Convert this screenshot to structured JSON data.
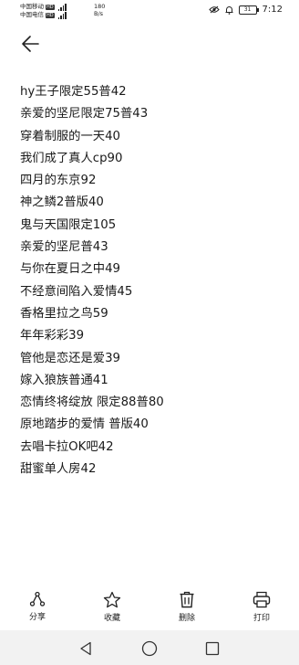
{
  "status": {
    "carrier1": "中国移动",
    "carrier2": "中国电信",
    "hd": "HD",
    "signal_label": "4G",
    "net_value": "180",
    "net_unit": "B/s",
    "battery": "31",
    "time": "7:12"
  },
  "header": {
    "back_icon": "arrow-left-icon"
  },
  "items": [
    "hy王子限定55普42",
    "亲爱的坚尼限定75普43",
    "穿着制服的一天40",
    "我们成了真人cp90",
    "四月的东京92",
    "神之鳞2普版40",
    "鬼与天国限定105",
    "亲爱的坚尼普43",
    "与你在夏日之中49",
    "不经意间陷入爱情45",
    "香格里拉之鸟59",
    "年年彩彩39",
    "管他是恋还是爱39",
    "嫁入狼族普通41",
    "恋情终将绽放 限定88普80",
    "原地踏步的爱情 普版40",
    "去唱卡拉OK吧42",
    "甜蜜单人房42"
  ],
  "toolbar": {
    "share": "分享",
    "favorite": "收藏",
    "delete": "删除",
    "print": "打印"
  }
}
